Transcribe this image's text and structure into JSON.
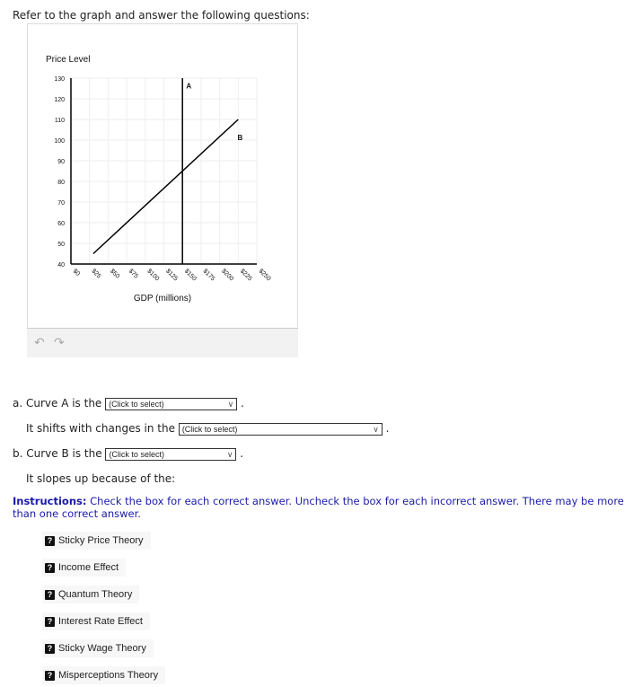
{
  "intro": "Refer to the graph and answer the following questions:",
  "chart_data": {
    "type": "line",
    "title": "",
    "ylabel": "Price Level",
    "xlabel": "GDP (millions)",
    "ylim": [
      40,
      130
    ],
    "xlim": [
      0,
      250
    ],
    "yticks": [
      40,
      50,
      60,
      70,
      80,
      90,
      100,
      110,
      120,
      130
    ],
    "xticks": [
      0,
      25,
      50,
      75,
      100,
      125,
      150,
      175,
      200,
      225,
      250
    ],
    "xtick_labels": [
      "$0",
      "$25",
      "$50",
      "$75",
      "$100",
      "$125",
      "$150",
      "$175",
      "$200",
      "$225",
      "$250"
    ],
    "ytick_labels": [
      "40",
      "50",
      "60",
      "70",
      "80",
      "90",
      "100",
      "110",
      "120",
      "130"
    ],
    "grid": true,
    "series": [
      {
        "name": "A",
        "points": [
          [
            150,
            40
          ],
          [
            150,
            130
          ]
        ],
        "label_at": [
          155,
          125
        ]
      },
      {
        "name": "B",
        "points": [
          [
            30,
            45
          ],
          [
            225,
            110
          ]
        ],
        "label_at": [
          224,
          100
        ]
      }
    ]
  },
  "toolbar": {
    "undo_icon": "undo-icon",
    "redo_icon": "redo-icon"
  },
  "questions": {
    "a_prefix": "a. Curve A is the",
    "a_select": "(Click to select)",
    "shift_prefix": "It shifts with changes in the",
    "shift_select": "(Click to select)",
    "b_prefix": "b. Curve B is the",
    "b_select": "(Click to select)",
    "slope_text": "It slopes up because of the:",
    "period": ".",
    "chevron": "∨"
  },
  "instructions": {
    "label": "Instructions:",
    "text": " Check the box for each correct answer.  Uncheck the box for each incorrect answer.  There may be more than one correct answer."
  },
  "options": [
    {
      "label": "Sticky Price Theory",
      "state": "?"
    },
    {
      "label": "Income Effect",
      "state": "?"
    },
    {
      "label": "Quantum Theory",
      "state": "?"
    },
    {
      "label": "Interest Rate Effect",
      "state": "?"
    },
    {
      "label": "Sticky Wage Theory",
      "state": "?"
    },
    {
      "label": "Misperceptions Theory",
      "state": "?"
    }
  ]
}
